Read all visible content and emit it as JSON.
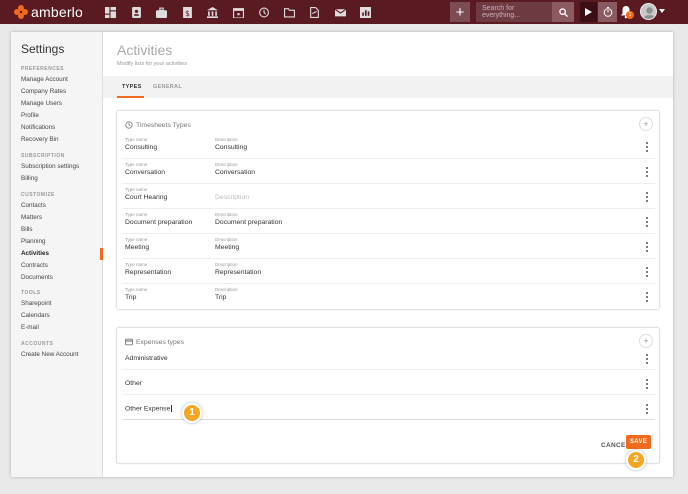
{
  "app": {
    "logo_text": "amberlo"
  },
  "topbar": {
    "nav_icons": [
      "dashboard-icon",
      "contacts-icon",
      "matters-icon",
      "bills-icon",
      "bank-icon",
      "calendar-icon",
      "history-icon",
      "folder-icon",
      "documents-icon",
      "mail-icon",
      "reports-icon"
    ],
    "add_label": "+",
    "search_placeholder": "Search for everything...",
    "notification_count": "1"
  },
  "sidebar": {
    "title": "Settings",
    "sections": [
      {
        "label": "PREFERENCES",
        "items": [
          "Manage Account",
          "Company Rates",
          "Manage Users",
          "Profile",
          "Notifications",
          "Recovery Bin"
        ]
      },
      {
        "label": "SUBSCRIPTION",
        "items": [
          "Subscription settings",
          "Billing"
        ]
      },
      {
        "label": "CUSTOMIZE",
        "items": [
          "Contacts",
          "Matters",
          "Bills",
          "Planning",
          "Activities",
          "Contracts",
          "Documents"
        ]
      },
      {
        "label": "TOOLS",
        "items": [
          "Sharepoint",
          "Calendars",
          "E-mail"
        ]
      },
      {
        "label": "ACCOUNTS",
        "items": [
          "Create New Account"
        ]
      }
    ],
    "active_item": "Activities"
  },
  "main": {
    "title": "Activities",
    "subtitle": "Modify lists for your activities",
    "tabs": [
      {
        "label": "TYPES"
      },
      {
        "label": "GENERAL"
      }
    ],
    "active_tab": "TYPES"
  },
  "timesheets": {
    "title": "Timesheets Types",
    "type_name_label": "Type name",
    "description_label": "Description",
    "description_placeholder": "Description",
    "rows": [
      {
        "name": "Consulting",
        "description": "Consulting"
      },
      {
        "name": "Conversation",
        "description": "Conversation"
      },
      {
        "name": "Court Hearing",
        "description": ""
      },
      {
        "name": "Document preparation",
        "description": "Document preparation"
      },
      {
        "name": "Meeting",
        "description": "Meeting"
      },
      {
        "name": "Representation",
        "description": "Representation"
      },
      {
        "name": "Trip",
        "description": "Trip"
      }
    ]
  },
  "expenses": {
    "title": "Expenses types",
    "rows": [
      "Administrative",
      "Other",
      "Other Expense"
    ],
    "cancel_label": "CANCEL",
    "save_label": "SAVE"
  },
  "callouts": [
    "1",
    "2"
  ],
  "colors": {
    "topbar": "#5a1a22",
    "accent": "#f26b1d",
    "callout": "#f6a623"
  }
}
